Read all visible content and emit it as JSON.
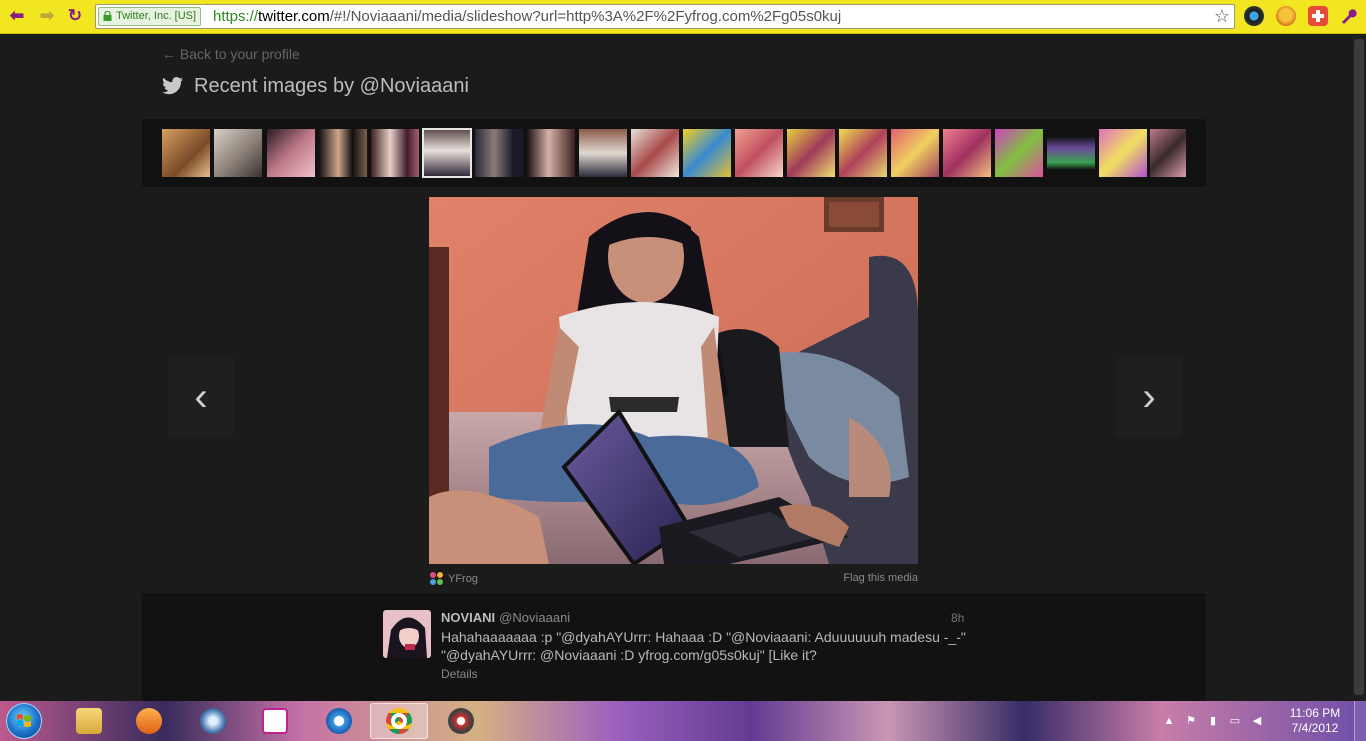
{
  "browser": {
    "ev_badge": "Twitter, Inc. [US]",
    "url_scheme": "https://",
    "url_host": "twitter.com",
    "url_path": "/#!/Noviaaani/media/slideshow?url=http%3A%2F%2Fyfrog.com%2Fg05s0kuj",
    "back_icon": "back-arrow-icon",
    "forward_icon": "forward-arrow-icon",
    "reload_icon": "reload-icon",
    "star_icon": "bookmark-star-icon",
    "back_glyph": "⬅",
    "forward_glyph": "➡",
    "reload_glyph": "↻",
    "star_glyph": "☆",
    "accent_color": "#f2e620"
  },
  "page": {
    "back_link": "← Back to your profile",
    "heading": "Recent images by @Noviaaani",
    "prev_glyph": "‹",
    "next_glyph": "›",
    "thumbnails_count_visible": 20,
    "selected_thumbnail_index": 5,
    "image_source": "YFrog",
    "flag_link": "Flag this media"
  },
  "tweet": {
    "name": "NOVIANI",
    "handle": "@Noviaaani",
    "time": "8h",
    "text": "Hahahaaaaaaa :p \"@dyahAYUrrr: Hahaaa :D \"@Noviaaani: Aduuuuuuh madesu -_-\" \"@dyahAYUrrr: @Noviaaani :D yfrog.com/g05s0kuj\" [Like it?",
    "details": "Details"
  },
  "taskbar": {
    "pinned": [
      "explorer",
      "media-player",
      "dvd-maker",
      "picsart",
      "internet-explorer",
      "chrome",
      "media-center"
    ],
    "active_app": "chrome",
    "clock_time": "11:06 PM",
    "clock_date": "7/4/2012"
  }
}
